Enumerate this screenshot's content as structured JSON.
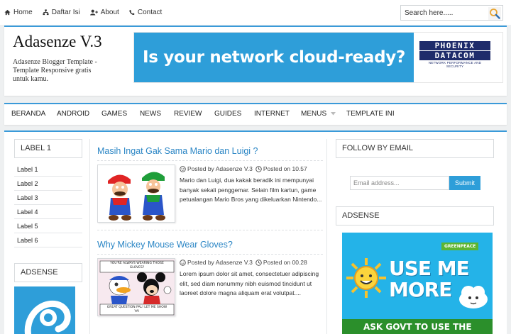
{
  "topnav": {
    "items": [
      {
        "label": "Home",
        "icon": "home-icon"
      },
      {
        "label": "Daftar Isi",
        "icon": "sitemap-icon"
      },
      {
        "label": "About",
        "icon": "user-plus-icon"
      },
      {
        "label": "Contact",
        "icon": "phone-icon"
      }
    ],
    "search_placeholder": "Search here....."
  },
  "header": {
    "title": "Adasenze V.3",
    "description": "Adasenze Blogger Template - Template Responsive gratis untuk kamu."
  },
  "banner": {
    "headline": "Is your network cloud-ready?",
    "logo_line1": "PHOENIX",
    "logo_line2": "DATACOM",
    "logo_tagline": "NETWORK PERFORMANCE AND SECURITY"
  },
  "mainmenu": {
    "items": [
      "BERANDA",
      "ANDROID",
      "GAMES",
      "NEWS",
      "REVIEW",
      "GUIDES",
      "INTERNET",
      "MENUS",
      "TEMPLATE INI"
    ]
  },
  "left_sidebar": {
    "label_heading": "LABEL 1",
    "labels": [
      "Label 1",
      "Label 2",
      "Label 3",
      "Label 4",
      "Label 5",
      "Label 6"
    ],
    "adsense_heading": "ADSENSE"
  },
  "posts": [
    {
      "title": "Masih Ingat Gak Sama Mario dan Luigi ?",
      "author": "Posted by Adasenze V.3",
      "time": "Posted on 10.57",
      "excerpt": "Mario dan Luigi, dua kakak beradik ini mempunyai banyak sekali penggemar. Selain film kartun, game petualangan Mario Bros yang dikeluarkan Nintendo..."
    },
    {
      "title": "Why Mickey Mouse Wear Gloves?",
      "author": "Posted by Adasenze V.3",
      "time": "Posted on 00.28",
      "excerpt": "Lorem ipsum dolor sit amet, consectetuer adipiscing elit, sed diam nonummy nibh euismod tincidunt ut laoreet dolore magna aliquam erat volutpat....",
      "comic_top": "YOU'RE ALWAYS WEARING THOSE GLOVES?",
      "comic_bottom": "GREAT QUESTION PAL! LET ME SHOW YA!"
    }
  ],
  "right_sidebar": {
    "follow_heading": "FOLLOW BY EMAIL",
    "email_placeholder": "Email address...",
    "submit_label": "Submit",
    "adsense_heading": "ADSENSE",
    "ad": {
      "brand": "GREENPEACE",
      "line1": "USE ME",
      "line2": "MORE",
      "line3": "ASK GOVT TO USE THE"
    }
  },
  "colors": {
    "accent": "#3a9ad9",
    "link": "#2b86c5",
    "banner_blue": "#2e9ed9",
    "background": "#eef0f1"
  }
}
